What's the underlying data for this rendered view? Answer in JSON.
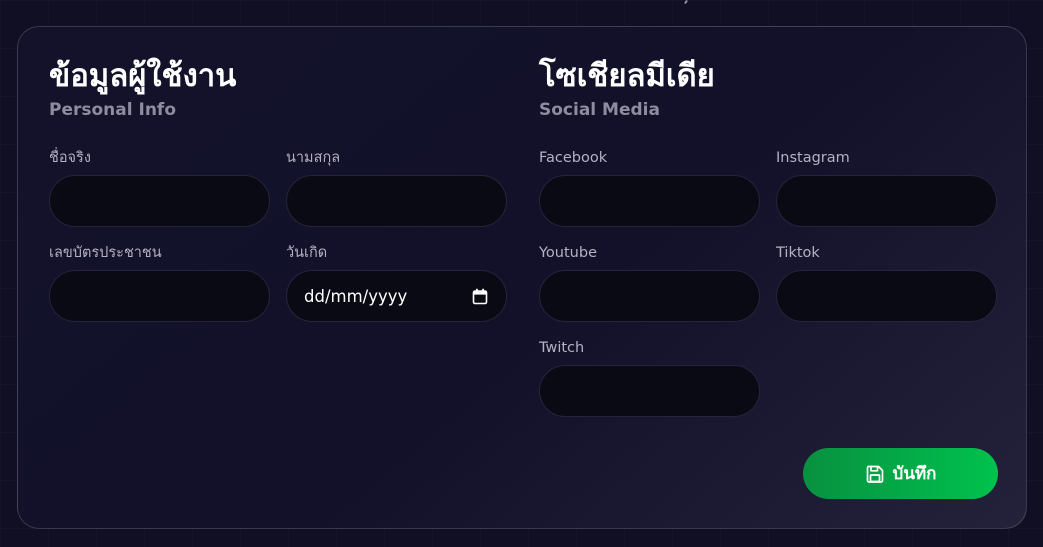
{
  "personal": {
    "title": "ข้อมูลผู้ใช้งาน",
    "subtitle": "Personal Info",
    "first_name": {
      "label": "ชื่อจริง",
      "value": ""
    },
    "last_name": {
      "label": "นามสกุล",
      "value": ""
    },
    "id_card": {
      "label": "เลขบัตรประชาชน",
      "value": ""
    },
    "birthday": {
      "label": "วันเกิด",
      "placeholder": "dd/mm/yyyy",
      "icon": "calendar-icon"
    }
  },
  "social": {
    "title": "โซเชียลมีเดีย",
    "subtitle": "Social Media",
    "facebook": {
      "label": "Facebook",
      "value": ""
    },
    "instagram": {
      "label": "Instagram",
      "value": ""
    },
    "youtube": {
      "label": "Youtube",
      "value": ""
    },
    "tiktok": {
      "label": "Tiktok",
      "value": ""
    },
    "twitch": {
      "label": "Twitch",
      "value": ""
    }
  },
  "save_button": {
    "label": "บันทึก",
    "icon": "save-icon"
  },
  "colors": {
    "background": "#100f24",
    "card": "#13122a",
    "input": "#0a0a15",
    "accent_start": "#089040",
    "accent_end": "#00c24e",
    "label": "#b3b1c2",
    "subtitle": "#8e8c9e"
  }
}
